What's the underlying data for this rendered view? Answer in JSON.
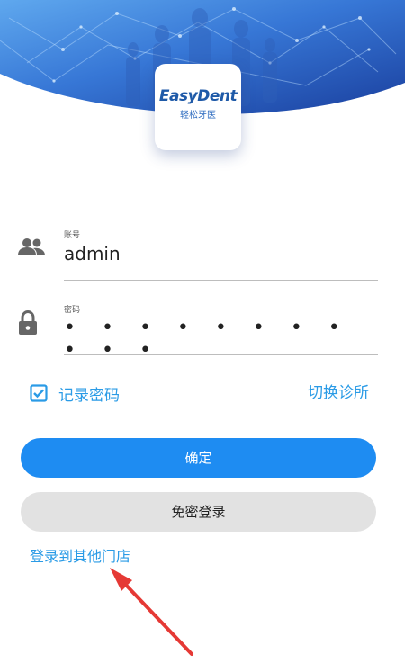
{
  "header": {
    "logo": {
      "name_en": "EasyDent",
      "name_cn": "轻松牙医"
    }
  },
  "form": {
    "account": {
      "label": "账号",
      "value": "admin",
      "icon": "people-icon"
    },
    "password": {
      "label": "密码",
      "value": "• • • • • • • • • • •",
      "icon": "lock-icon"
    }
  },
  "options": {
    "remember_label": "记录密码",
    "remember_checked": true,
    "switch_clinic_label": "切换诊所"
  },
  "buttons": {
    "confirm_label": "确定",
    "passwordless_label": "免密登录"
  },
  "links": {
    "other_store_label": "登录到其他门店"
  },
  "colors": {
    "accent": "#1e8cf2",
    "link": "#2a9be6",
    "header_dark": "#1a3f9e",
    "header_light": "#4f9be8",
    "annotation_arrow": "#e53935"
  }
}
